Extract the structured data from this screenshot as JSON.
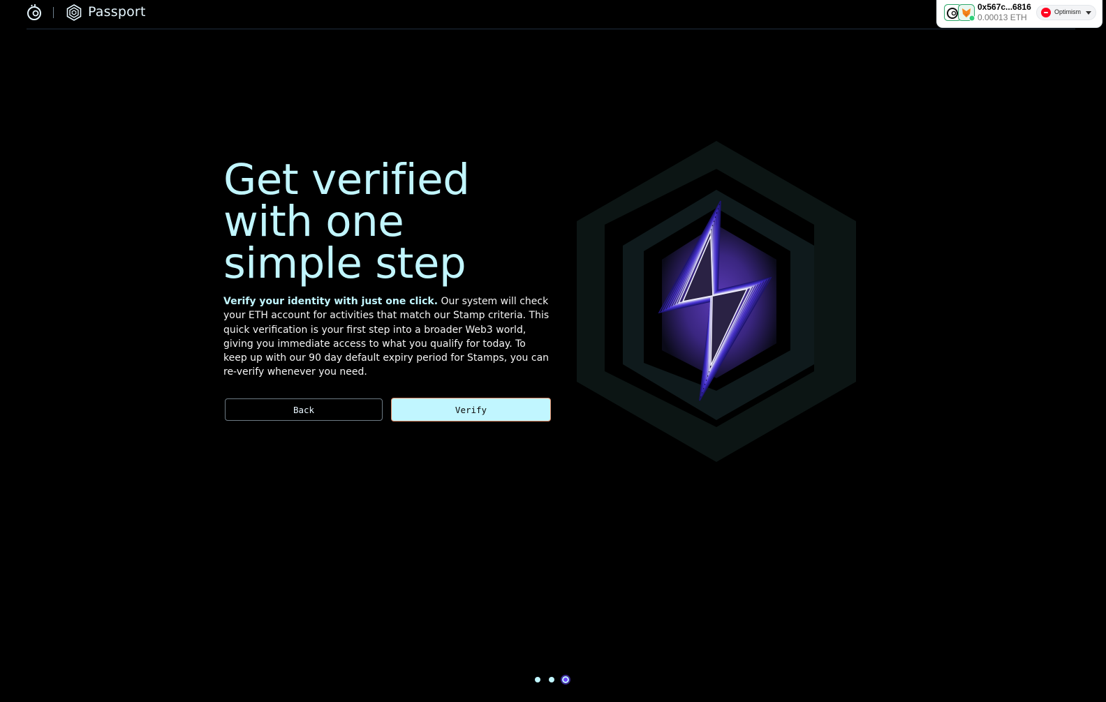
{
  "header": {
    "brand_name": "Passport"
  },
  "wallet": {
    "address": "0x567c...6816",
    "balance": "0.00013 ETH",
    "network": "Optimism",
    "network_color": "#ff0420"
  },
  "main": {
    "headline_line1": "Get verified",
    "headline_line2": "with one",
    "headline_line3": "simple step",
    "lead": "Verify your identity with just one click.",
    "body": " Our system will check your ETH account for activities that match our Stamp criteria. This quick verification is your first step into a broader Web3 world, giving you immediate access to what you qualify for today. To keep up with our 90 day default expiry period for Stamps, you can re-verify whenever you need.",
    "back_label": "Back",
    "verify_label": "Verify"
  },
  "pagination": {
    "total": 3,
    "active": 3
  },
  "colors": {
    "background": "#000000",
    "accent": "#c1f6ff",
    "purple": "#6e44ff"
  }
}
